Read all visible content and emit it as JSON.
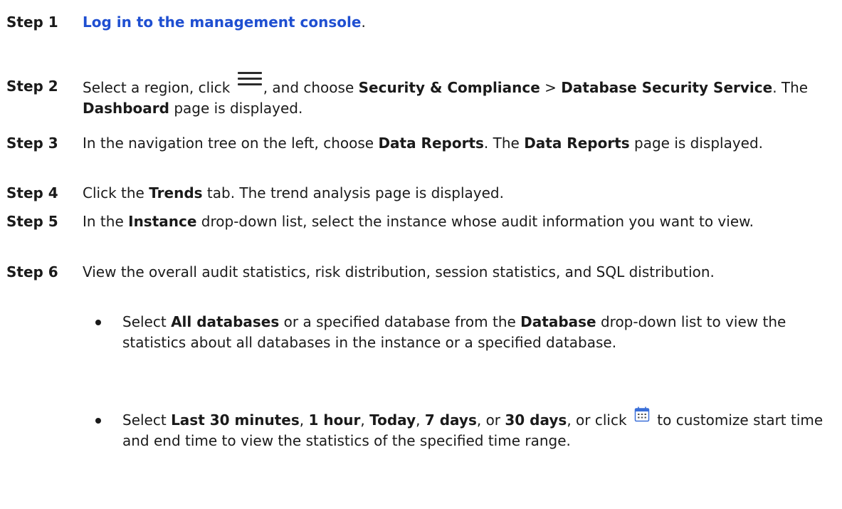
{
  "steps": [
    {
      "label": "Step 1",
      "link": "Log in to the management console",
      "after": "."
    },
    {
      "label": "Step 2",
      "t1": "Select a region, click ",
      "t2": ", and choose ",
      "b1": "Security & Compliance",
      "t3": " > ",
      "b2": "Database Security Service",
      "t4": ". The ",
      "b3": "Dashboard",
      "t5": " page is displayed."
    },
    {
      "label": "Step 3",
      "t1": "In the navigation tree on the left, choose ",
      "b1": "Data Reports",
      "t2": ". The ",
      "b2": "Data Reports",
      "t3": " page is displayed."
    },
    {
      "label": "Step 4",
      "t1": "Click the ",
      "b1": "Trends",
      "t2": " tab. The trend analysis page is displayed."
    },
    {
      "label": "Step 5",
      "t1": "In the ",
      "b1": "Instance",
      "t2": " drop-down list, select the instance whose audit information you want to view."
    },
    {
      "label": "Step 6",
      "t1": "View the overall audit statistics, risk distribution, session statistics, and SQL distribution."
    }
  ],
  "bullets": [
    {
      "t1": "Select ",
      "b1": "All databases",
      "t2": " or a specified database from the ",
      "b2": "Database",
      "t3": " drop-down list to view the statistics about all databases in the instance or a specified database."
    },
    {
      "t1": "Select ",
      "b1": "Last 30 minutes",
      "t2": ", ",
      "b2": "1 hour",
      "t3": ", ",
      "b3": "Today",
      "t4": ", ",
      "b4": "7 days",
      "t5": ", or ",
      "b5": "30 days",
      "t6": ", or click ",
      "t7": " to customize start time and end time to view the statistics of the specified time range."
    }
  ],
  "icons": {
    "menu": "hamburger-menu-icon",
    "calendar": "calendar-icon"
  },
  "colors": {
    "link": "#1f4fd1",
    "text": "#1a1a1a"
  }
}
